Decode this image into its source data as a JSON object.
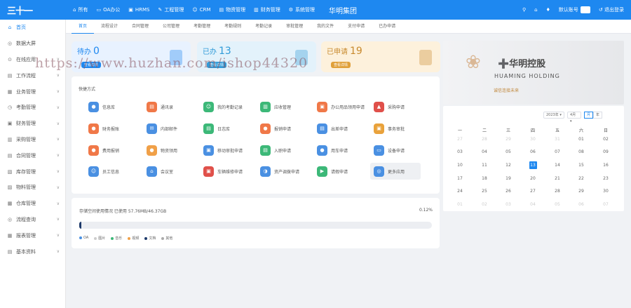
{
  "topbar": {
    "logo": "三十一",
    "nav": [
      {
        "icon": "⌂",
        "label": "所有"
      },
      {
        "icon": "▭",
        "label": "OA办公"
      },
      {
        "icon": "▣",
        "label": "HRMS"
      },
      {
        "icon": "✎",
        "label": "工程管理"
      },
      {
        "icon": "☺",
        "label": "CRM"
      },
      {
        "icon": "▤",
        "label": "物资管理"
      },
      {
        "icon": "▥",
        "label": "财务管理"
      },
      {
        "icon": "⚙",
        "label": "系统管理"
      }
    ],
    "company": "华明集团",
    "user_name": "默认账号",
    "logout": "退出登录"
  },
  "sidebar": {
    "items": [
      {
        "icon": "⌂",
        "label": "首页",
        "active": true
      },
      {
        "icon": "◎",
        "label": "数据大屏"
      },
      {
        "icon": "⊙",
        "label": "在线应用"
      },
      {
        "icon": "▤",
        "label": "工作流程"
      },
      {
        "icon": "▦",
        "label": "业务管理"
      },
      {
        "icon": "◷",
        "label": "考勤管理"
      },
      {
        "icon": "▣",
        "label": "财务管理"
      },
      {
        "icon": "▥",
        "label": "采购管理"
      },
      {
        "icon": "▤",
        "label": "合同管理"
      },
      {
        "icon": "▧",
        "label": "库存管理"
      },
      {
        "icon": "▨",
        "label": "物料管理"
      },
      {
        "icon": "▩",
        "label": "仓库管理"
      },
      {
        "icon": "◎",
        "label": "流程查询"
      },
      {
        "icon": "▦",
        "label": "报表管理"
      },
      {
        "icon": "▤",
        "label": "基本资料"
      }
    ]
  },
  "tabs": [
    "首页",
    "流程设计",
    "合同管理",
    "公司管理",
    "考勤管理",
    "考勤规则",
    "考勤记录",
    "审批管理",
    "我的文件",
    "支付申请",
    "已办申请"
  ],
  "stats": [
    {
      "label": "待办",
      "value": "0",
      "badge": "查看详情",
      "color": "#e8f2ff",
      "text": "#1e88f0",
      "badge_bg": "#1e88f0"
    },
    {
      "label": "已办",
      "value": "13",
      "badge": "查看详情",
      "color": "#e3f2fb",
      "text": "#2f9ad8",
      "badge_bg": "#2f9ad8"
    },
    {
      "label": "已申请",
      "value": "19",
      "badge": "查看详情",
      "color": "#fdf1dc",
      "text": "#c88a2e",
      "badge_bg": "#e0a03a"
    }
  ],
  "quick": {
    "title": "快捷方式",
    "items": [
      {
        "label": "信息库",
        "color": "#4a90e2",
        "icon": "●"
      },
      {
        "label": "通讯录",
        "color": "#f07848",
        "icon": "▤"
      },
      {
        "label": "我的考勤记录",
        "color": "#3cb878",
        "icon": "☺"
      },
      {
        "label": "应收管理",
        "color": "#3cb878",
        "icon": "▥"
      },
      {
        "label": "办公用品领用申请",
        "color": "#f07848",
        "icon": "▣"
      },
      {
        "label": "采购申请",
        "color": "#e0504a",
        "icon": "▲"
      },
      {
        "label": "财务报账",
        "color": "#f07848",
        "icon": "●"
      },
      {
        "label": "内部邮件",
        "color": "#4a90e2",
        "icon": "✉"
      },
      {
        "label": "日志库",
        "color": "#3cb878",
        "icon": "▤"
      },
      {
        "label": "报销申请",
        "color": "#f07848",
        "icon": "●"
      },
      {
        "label": "出差申请",
        "color": "#4a90e2",
        "icon": "▤"
      },
      {
        "label": "事务审批",
        "color": "#e9a23b",
        "icon": "▣"
      },
      {
        "label": "费用报销",
        "color": "#f07848",
        "icon": "●"
      },
      {
        "label": "物资领用",
        "color": "#f0a048",
        "icon": "●"
      },
      {
        "label": "移动审批申请",
        "color": "#4a90e2",
        "icon": "▣"
      },
      {
        "label": "入职申请",
        "color": "#3cb878",
        "icon": "▤"
      },
      {
        "label": "用车申请",
        "color": "#4a90e2",
        "icon": "●"
      },
      {
        "label": "设备申请",
        "color": "#4a90e2",
        "icon": "▭"
      },
      {
        "label": "员工信息",
        "color": "#4a90e2",
        "icon": "☺"
      },
      {
        "label": "会议室",
        "color": "#4a90e2",
        "icon": "⌂"
      },
      {
        "label": "车辆维修申请",
        "color": "#e0504a",
        "icon": "▣"
      },
      {
        "label": "资产调拨申请",
        "color": "#4a90e2",
        "icon": "◑"
      },
      {
        "label": "请假申请",
        "color": "#3cb878",
        "icon": "▶"
      },
      {
        "label": "更多应用",
        "color": "#4a90e2",
        "icon": "◎"
      }
    ]
  },
  "storage": {
    "title": "存储空间使用情况 已使用 57.76MB/46.37GB",
    "percent_label": "0.12%",
    "fill_fraction": 0.0012,
    "legend": [
      {
        "label": "OA",
        "color": "#4a90e2"
      },
      {
        "label": "图片",
        "color": "#cccccc"
      },
      {
        "label": "音乐",
        "color": "#3cb878"
      },
      {
        "label": "视频",
        "color": "#f0a048"
      },
      {
        "label": "文档",
        "color": "#1e3a6b"
      },
      {
        "label": "其他",
        "color": "#aaaaaa"
      }
    ]
  },
  "banner": {
    "brand": "➕华明控股",
    "sub": "HUAMING HOLDING",
    "tag": "诚信连接未来"
  },
  "calendar": {
    "year": "2023年",
    "month": "4月",
    "mode_month": "月",
    "mode_year": "年",
    "weekdays": [
      "一",
      "二",
      "三",
      "四",
      "五",
      "六",
      "日"
    ],
    "weeks": [
      [
        "27",
        "28",
        "29",
        "30",
        "31",
        "01",
        "02"
      ],
      [
        "03",
        "04",
        "05",
        "06",
        "07",
        "08",
        "09"
      ],
      [
        "10",
        "11",
        "12",
        "13",
        "14",
        "15",
        "16"
      ],
      [
        "17",
        "18",
        "19",
        "20",
        "21",
        "22",
        "23"
      ],
      [
        "24",
        "25",
        "26",
        "27",
        "28",
        "29",
        "30"
      ],
      [
        "01",
        "02",
        "03",
        "04",
        "05",
        "06",
        "07"
      ]
    ],
    "today": "13"
  },
  "watermark": "https://www.huzhan.com/ishop44320"
}
